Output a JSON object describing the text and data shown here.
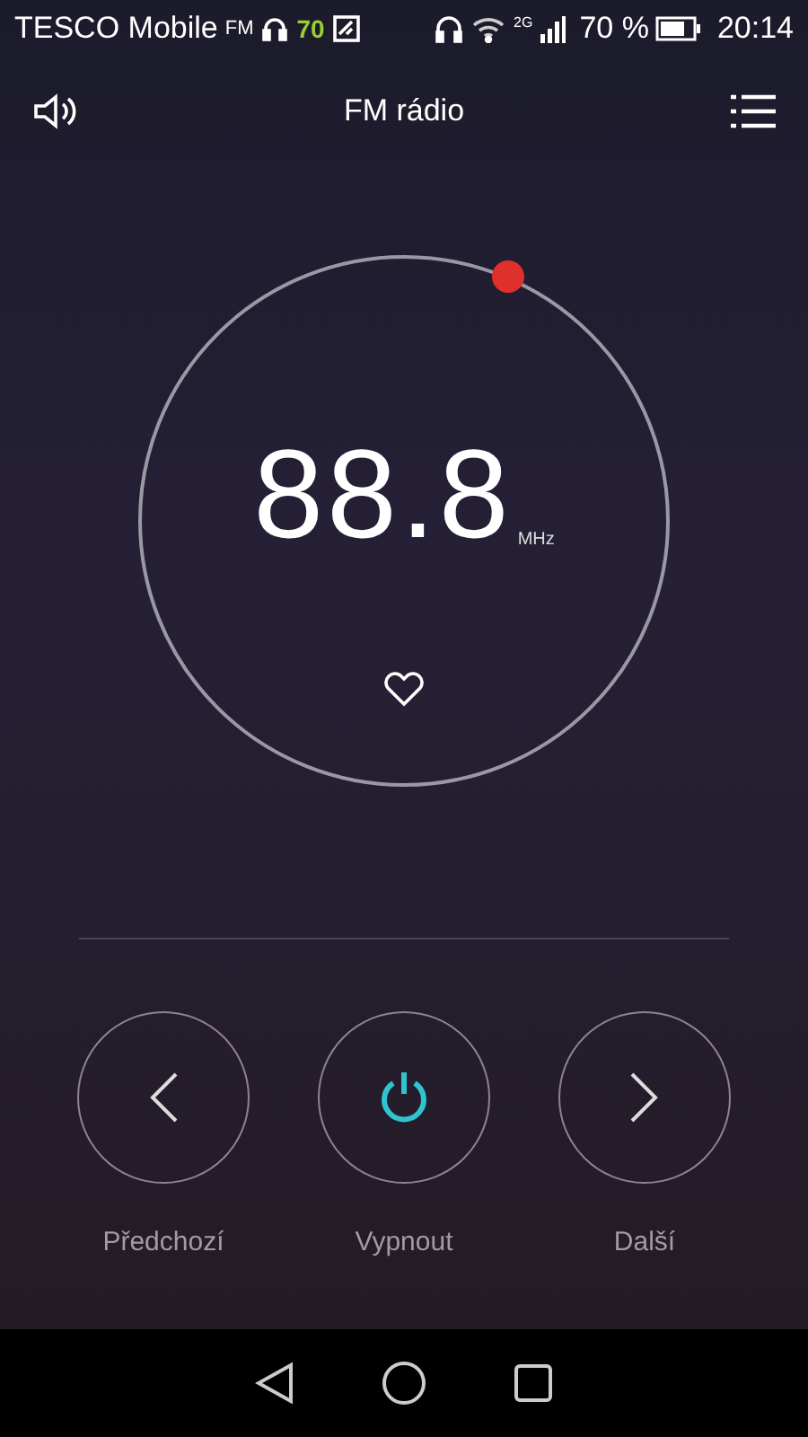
{
  "status_bar": {
    "carrier": "TESCO Mobile",
    "fm": "FM",
    "notification_count": "70",
    "network": "2G",
    "battery": "70 %",
    "time": "20:14"
  },
  "header": {
    "title": "FM rádio"
  },
  "tuner": {
    "frequency": "88.8",
    "unit": "MHz",
    "favorite": false
  },
  "controls": [
    {
      "kind": "previous",
      "label": "Předchozí"
    },
    {
      "kind": "power",
      "label": "Vypnout",
      "on": true
    },
    {
      "kind": "next",
      "label": "Další"
    }
  ]
}
